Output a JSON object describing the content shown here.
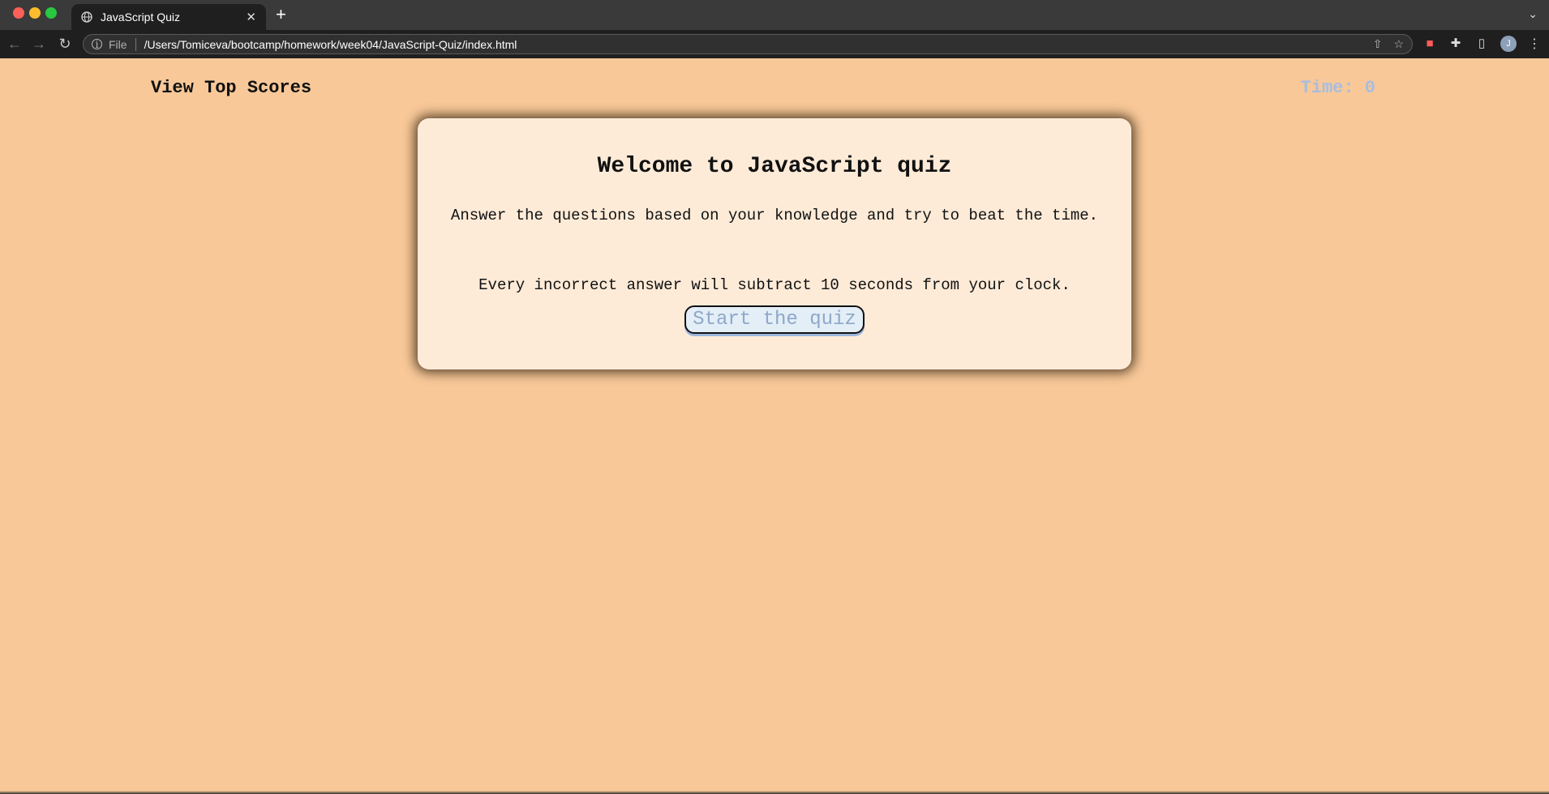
{
  "browser": {
    "tab_title": "JavaScript Quiz",
    "tab_close": "✕",
    "new_tab": "+",
    "tab_menu": "⌄",
    "scheme_label": "File",
    "url": "/Users/Tomiceva/bootcamp/homework/week04/JavaScript-Quiz/index.html",
    "avatar_initial": "J",
    "icons": {
      "back": "arrow-left-icon",
      "forward": "arrow-right-icon",
      "reload": "reload-icon",
      "info": "info-icon",
      "share": "share-icon",
      "bookmark": "star-icon",
      "extension_recorder": "record-icon",
      "extensions": "puzzle-icon",
      "side_panel": "side-panel-icon",
      "menu": "more-vertical-icon"
    }
  },
  "header": {
    "view_scores_label": "View Top Scores",
    "timer_text": "Time: 0"
  },
  "quiz_card": {
    "title": "Welcome to JavaScript quiz",
    "description": "Answer the questions based on your knowledge and try to beat the time.",
    "warning": "Every incorrect answer will subtract 10 seconds from your clock.",
    "start_label": "Start the quiz"
  },
  "colors": {
    "page_background": "#f8c898",
    "card_background": "#fdebd8",
    "timer_color": "#a8bde0",
    "button_text": "#8ea8c8"
  }
}
